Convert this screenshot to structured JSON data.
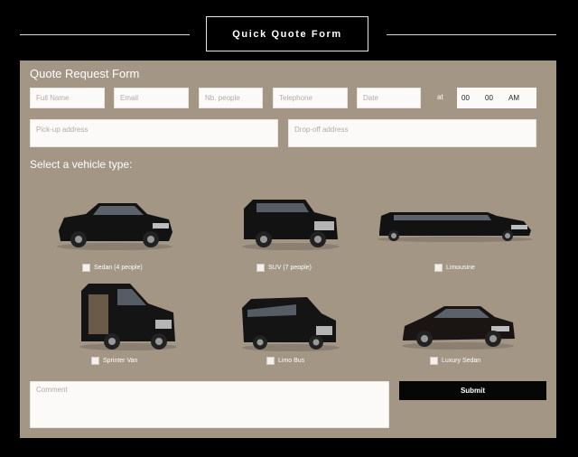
{
  "header": {
    "title": "Quick Quote Form"
  },
  "form": {
    "title": "Quote Request Form",
    "fields": {
      "full_name": "Full Name",
      "email": "Email",
      "nb_people": "Nb. people",
      "telephone": "Telephone",
      "date": "Date",
      "pickup": "Pick-up address",
      "dropoff": "Drop-off address",
      "comment": "Comment"
    },
    "at_label": "at",
    "time": {
      "hour": "00",
      "minute": "00",
      "ampm": "AM"
    }
  },
  "vehicles": {
    "section_title": "Select a vehicle type:",
    "items": [
      {
        "label": "Sedan (4 people)",
        "icon": "sedan-icon"
      },
      {
        "label": "SUV (7 people)",
        "icon": "suv-icon"
      },
      {
        "label": "Limousine",
        "icon": "limousine-icon"
      },
      {
        "label": "Sprinter Van",
        "icon": "sprinter-van-icon"
      },
      {
        "label": "Limo Bus",
        "icon": "limo-bus-icon"
      },
      {
        "label": "Luxury Sedan",
        "icon": "luxury-sedan-icon"
      }
    ]
  },
  "submit_label": "Submit",
  "colors": {
    "panel": "#a39684",
    "background": "#000000",
    "field": "#fbfaf8"
  }
}
